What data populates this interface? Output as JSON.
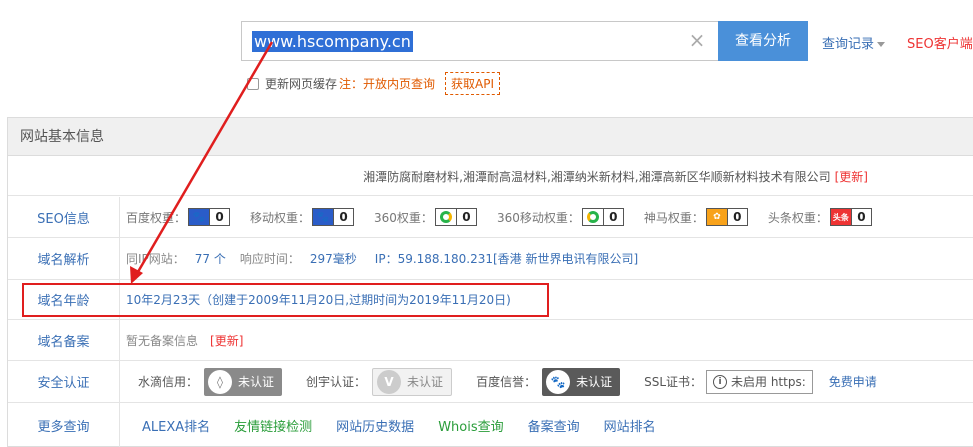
{
  "search": {
    "value": "www.hscompany.cn",
    "button": "查看分析",
    "history": "查询记录",
    "seo_client": "SEO客户端"
  },
  "cache": {
    "label": "更新网页缓存",
    "note": "注：开放内页查询",
    "api": "获取API"
  },
  "panel": {
    "title": "网站基本信息",
    "company": "湘潭防腐耐磨材料,湘潭耐高温材料,湘潭纳米新材料,湘潭高新区华顺新材料技术有限公司",
    "company_update": "[更新]"
  },
  "seo": {
    "label": "SEO信息",
    "items": [
      {
        "name": "百度权重：",
        "value": "0",
        "icon": "baidu-paw-icon"
      },
      {
        "name": "移动权重：",
        "value": "0",
        "icon": "baidu-paw-icon"
      },
      {
        "name": "360权重：",
        "value": "0",
        "icon": "360-icon"
      },
      {
        "name": "360移动权重：",
        "value": "0",
        "icon": "360-icon"
      },
      {
        "name": "神马权重：",
        "value": "0",
        "icon": "shenma-icon"
      },
      {
        "name": "头条权重：",
        "value": "0",
        "icon": "toutiao-icon"
      }
    ],
    "toutiao_icon_text": "头条"
  },
  "dns": {
    "label": "域名解析",
    "same_ip_label": "同IP网站：",
    "same_ip_value": "77 个",
    "response_label": "响应时间：",
    "response_value": "297毫秒",
    "ip": "IP：59.188.180.231[香港 新世界电讯有限公司]"
  },
  "age": {
    "label": "域名年龄",
    "value": "10年2月23天（创建于2009年11月20日,过期时间为2019年11月20日)"
  },
  "icp": {
    "label": "域名备案",
    "value": "暂无备案信息",
    "update": "[更新]"
  },
  "security": {
    "label": "安全认证",
    "shuidi_label": "水滴信用：",
    "shuidi_badge": "未认证",
    "chuangyu_label": "创宇认证：",
    "chuangyu_badge": "未认证",
    "baidu_label": "百度信誉：",
    "baidu_badge": "未认证",
    "ssl_label": "SSL证书：",
    "ssl_value": "未启用 https:",
    "free_apply": "免费申请"
  },
  "more": {
    "label": "更多查询",
    "links": [
      "ALEXA排名",
      "友情链接检测",
      "网站历史数据",
      "Whois查询",
      "备案查询",
      "网站排名"
    ]
  },
  "colors": {
    "accent_blue": "#4a90d9",
    "link_blue": "#3a6fb5",
    "highlight_red": "#e01e1e",
    "note_orange": "#e05a00"
  }
}
